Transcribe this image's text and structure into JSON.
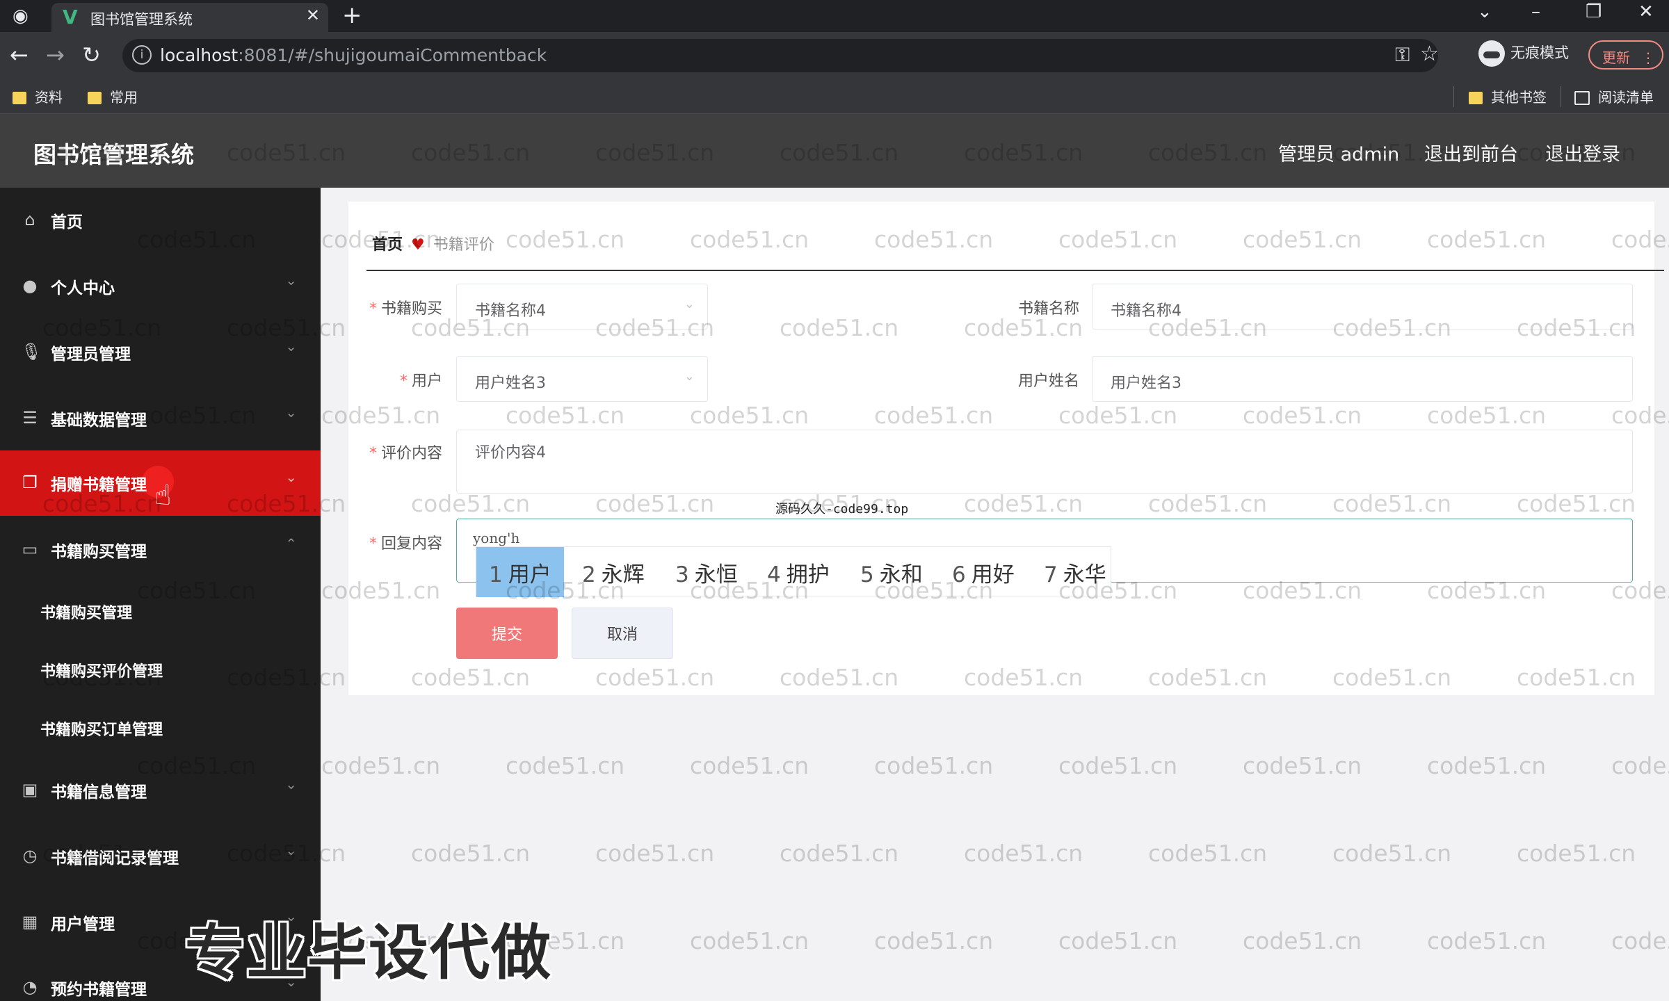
{
  "browser": {
    "tab_title": "图书馆管理系统",
    "url_host": "localhost",
    "url_path": ":8081/#/shujigoumaiCommentback",
    "incognito_label": "无痕模式",
    "update_label": "更新",
    "bookmarks": [
      "资料",
      "常用"
    ],
    "other_bookmarks": "其他书签",
    "reading_list": "阅读清单"
  },
  "header": {
    "title": "图书馆管理系统",
    "admin": "管理员 admin",
    "back_to_front": "退出到前台",
    "logout": "退出登录"
  },
  "sidebar": {
    "items": [
      {
        "label": "首页",
        "icon": "home-icon"
      },
      {
        "label": "个人中心",
        "icon": "user-icon"
      },
      {
        "label": "管理员管理",
        "icon": "mic-icon"
      },
      {
        "label": "基础数据管理",
        "icon": "sliders-icon"
      },
      {
        "label": "捐赠书籍管理",
        "icon": "copy-icon"
      },
      {
        "label": "书籍购买管理",
        "icon": "card-icon"
      },
      {
        "label": "书籍信息管理",
        "icon": "trash-icon"
      },
      {
        "label": "书籍借阅记录管理",
        "icon": "clock-icon"
      },
      {
        "label": "用户管理",
        "icon": "grid-icon"
      },
      {
        "label": "预约书籍管理",
        "icon": "reservation-icon"
      }
    ],
    "sub_items": [
      "书籍购买管理",
      "书籍购买评价管理",
      "书籍购买订单管理"
    ]
  },
  "breadcrumb": {
    "home": "首页",
    "current": "书籍评价"
  },
  "form": {
    "book_purchase_label": "书籍购买",
    "book_purchase_value": "书籍名称4",
    "book_name_label": "书籍名称",
    "book_name_value": "书籍名称4",
    "user_label": "用户",
    "user_value": "用户姓名3",
    "user_name_label": "用户姓名",
    "user_name_value": "用户姓名3",
    "comment_label": "评价内容",
    "comment_value": "评价内容4",
    "reply_label": "回复内容",
    "reply_value": "yong'h",
    "submit": "提交",
    "cancel": "取消"
  },
  "ime": {
    "candidates": [
      {
        "num": "1",
        "text": "用户"
      },
      {
        "num": "2",
        "text": "永辉"
      },
      {
        "num": "3",
        "text": "永恒"
      },
      {
        "num": "4",
        "text": "拥护"
      },
      {
        "num": "5",
        "text": "永和"
      },
      {
        "num": "6",
        "text": "用好"
      },
      {
        "num": "7",
        "text": "永华"
      }
    ]
  },
  "overlay": {
    "watermark": "code51.cn",
    "promo_text": "专业毕设代做",
    "source_watermark": "源码久久-code99.top"
  }
}
